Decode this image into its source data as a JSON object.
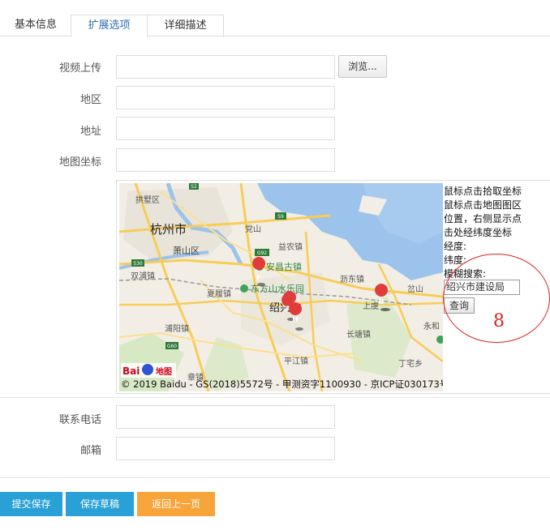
{
  "tabs": [
    {
      "label": "基本信息"
    },
    {
      "label": "扩展选项"
    },
    {
      "label": "详细描述"
    }
  ],
  "form": {
    "video_label": "视频上传",
    "browse_label": "浏览...",
    "region_label": "地区",
    "address_label": "地址",
    "coords_label": "地图坐标",
    "phone_label": "联系电话",
    "email_label": "邮箱"
  },
  "map": {
    "copyright": "© 2019 Baidu - GS(2018)5572号 - 甲测资字1100930 - 京ICP证030173号",
    "logo_text": "Bai",
    "logo_text2": "地图",
    "places": {
      "hangzhou": "杭州市",
      "xiaoshan": "萧山区",
      "gongshu": "拱墅区",
      "shuanglin": "双浦镇",
      "xialong": "夏履镇",
      "yichang": "益农镇",
      "anchang": "安昌古镇",
      "dongfang": "东方山水乐园",
      "shaoxing": "绍兴市",
      "lidong": "沥东镇",
      "shangyu": "上虞",
      "puyang": "浦阳镇",
      "pingjiang": "平江镇",
      "changtang": "长塘镇",
      "dingzhai": "丁宅乡",
      "yonghe": "永和",
      "zhangzhen": "章镇",
      "ganshan": "岔山",
      "dandong": "党山",
      "g92": "G92",
      "s9": "S9",
      "s30": "S30",
      "g60": "G60",
      "s2": "S2"
    },
    "markers": [
      "A",
      "B",
      "F",
      "H"
    ]
  },
  "sidebar": {
    "line1": "鼠标点击拾取坐标",
    "line2": "鼠标点击地图图区",
    "line3": "位置，右侧显示点",
    "line4": "击处经纬度坐标",
    "lng_label": "经度:",
    "lat_label": "纬度:",
    "search_label": "模糊搜索:",
    "search_value": "绍兴市建设局",
    "query_label": "查询"
  },
  "annotation": {
    "number": "8"
  },
  "buttons": {
    "submit": "提交保存",
    "draft": "保存草稿",
    "back": "返回上一页"
  },
  "colors": {
    "accent_blue": "#29a0d6",
    "accent_orange": "#f7a43b",
    "annotation_red": "#d22"
  }
}
